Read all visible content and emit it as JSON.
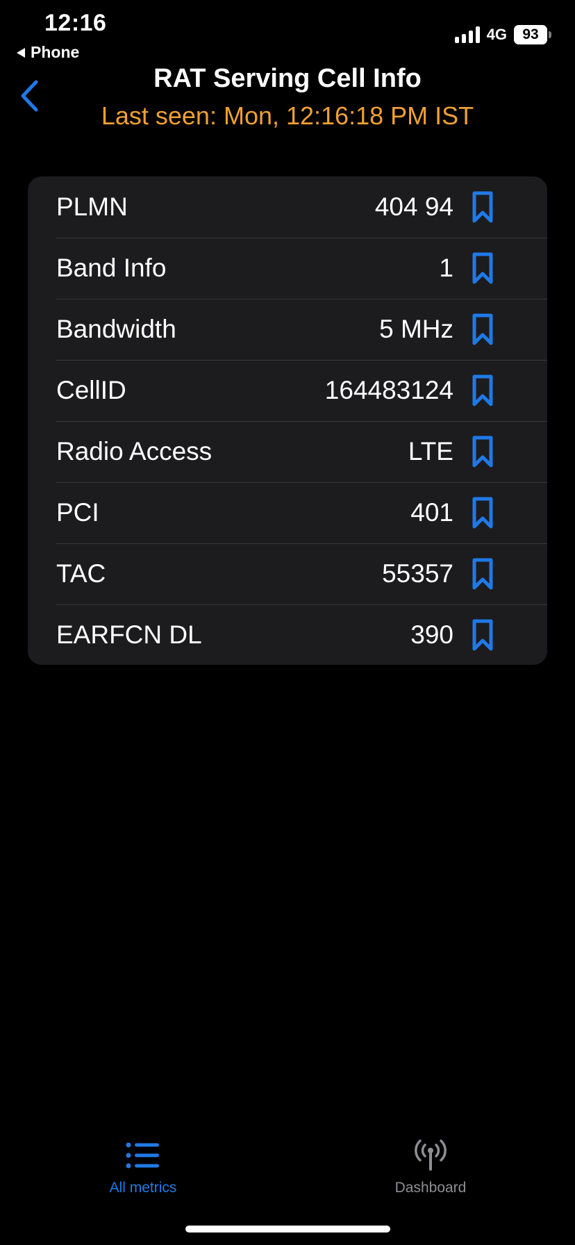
{
  "status_bar": {
    "time": "12:16",
    "back_app": "Phone",
    "network": "4G",
    "battery": "93"
  },
  "header": {
    "title": "RAT Serving Cell Info",
    "subtitle": "Last seen: Mon, 12:16:18 PM IST",
    "subtitle_color": "#f0a033"
  },
  "rows": [
    {
      "label": "PLMN",
      "value": "404 94"
    },
    {
      "label": "Band Info",
      "value": "1"
    },
    {
      "label": "Bandwidth",
      "value": "5 MHz"
    },
    {
      "label": "CellID",
      "value": "164483124"
    },
    {
      "label": "Radio Access",
      "value": "LTE"
    },
    {
      "label": "PCI",
      "value": "401"
    },
    {
      "label": "TAC",
      "value": "55357"
    },
    {
      "label": "EARFCN DL",
      "value": "390"
    }
  ],
  "tabs": [
    {
      "label": "All metrics",
      "icon": "list-icon",
      "selected": true
    },
    {
      "label": "Dashboard",
      "icon": "antenna-icon",
      "selected": false
    }
  ],
  "colors": {
    "accent": "#1f7ae8",
    "card": "#1c1c1e",
    "background": "#000000"
  }
}
